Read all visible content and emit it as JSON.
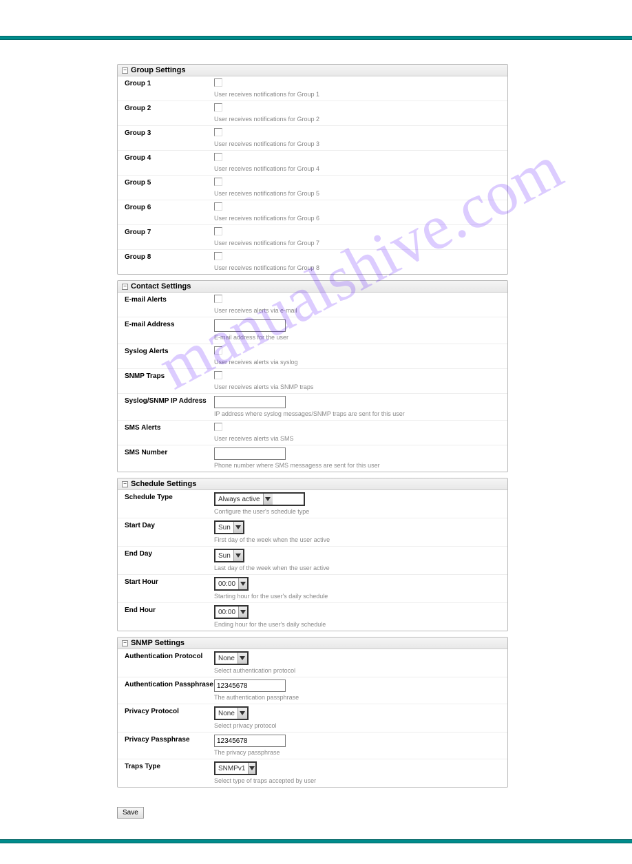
{
  "watermark": "manualshive.com",
  "sections": {
    "group": {
      "title": "Group Settings",
      "rows": [
        {
          "label": "Group 1",
          "helper": "User receives notifications for Group 1"
        },
        {
          "label": "Group 2",
          "helper": "User receives notifications for Group 2"
        },
        {
          "label": "Group 3",
          "helper": "User receives notifications for Group 3"
        },
        {
          "label": "Group 4",
          "helper": "User receives notifications for Group 4"
        },
        {
          "label": "Group 5",
          "helper": "User receives notifications for Group 5"
        },
        {
          "label": "Group 6",
          "helper": "User receives notifications for Group 6"
        },
        {
          "label": "Group 7",
          "helper": "User receives notifications for Group 7"
        },
        {
          "label": "Group 8",
          "helper": "User receives notifications for Group 8"
        }
      ]
    },
    "contact": {
      "title": "Contact Settings",
      "email_alerts": {
        "label": "E-mail Alerts",
        "helper": "User receives alerts via e-mail"
      },
      "email_address": {
        "label": "E-mail Address",
        "value": "",
        "helper": "E-mail address for the user"
      },
      "syslog_alerts": {
        "label": "Syslog Alerts",
        "helper": "User receives alerts via syslog"
      },
      "snmp_traps": {
        "label": "SNMP Traps",
        "helper": "User receives alerts via SNMP traps"
      },
      "syslog_ip": {
        "label": "Syslog/SNMP IP Address",
        "value": "",
        "helper": "IP address where syslog messages/SNMP traps are sent for this user"
      },
      "sms_alerts": {
        "label": "SMS Alerts",
        "helper": "User receives alerts via SMS"
      },
      "sms_number": {
        "label": "SMS Number",
        "value": "",
        "helper": "Phone number where SMS messagess are sent for this user"
      }
    },
    "schedule": {
      "title": "Schedule Settings",
      "schedule_type": {
        "label": "Schedule Type",
        "value": "Always active",
        "helper": "Configure the user's schedule type"
      },
      "start_day": {
        "label": "Start Day",
        "value": "Sun",
        "helper": "First day of the week when the user active"
      },
      "end_day": {
        "label": "End Day",
        "value": "Sun",
        "helper": "Last day of the week when the user active"
      },
      "start_hour": {
        "label": "Start Hour",
        "value": "00:00",
        "helper": "Starting hour for the user's daily schedule"
      },
      "end_hour": {
        "label": "End Hour",
        "value": "00:00",
        "helper": "Ending hour for the user's daily schedule"
      }
    },
    "snmp": {
      "title": "SNMP Settings",
      "auth_proto": {
        "label": "Authentication Protocol",
        "value": "None",
        "helper": "Select authentication protocol"
      },
      "auth_pass": {
        "label": "Authentication Passphrase",
        "value": "12345678",
        "helper": "The authentication passphrase"
      },
      "priv_proto": {
        "label": "Privacy Protocol",
        "value": "None",
        "helper": "Select privacy protocol"
      },
      "priv_pass": {
        "label": "Privacy Passphrase",
        "value": "12345678",
        "helper": "The privacy passphrase"
      },
      "traps_type": {
        "label": "Traps Type",
        "value": "SNMPv1",
        "helper": "Select type of traps accepted by user"
      }
    }
  },
  "save_button": "Save",
  "collapse_glyph": "−"
}
